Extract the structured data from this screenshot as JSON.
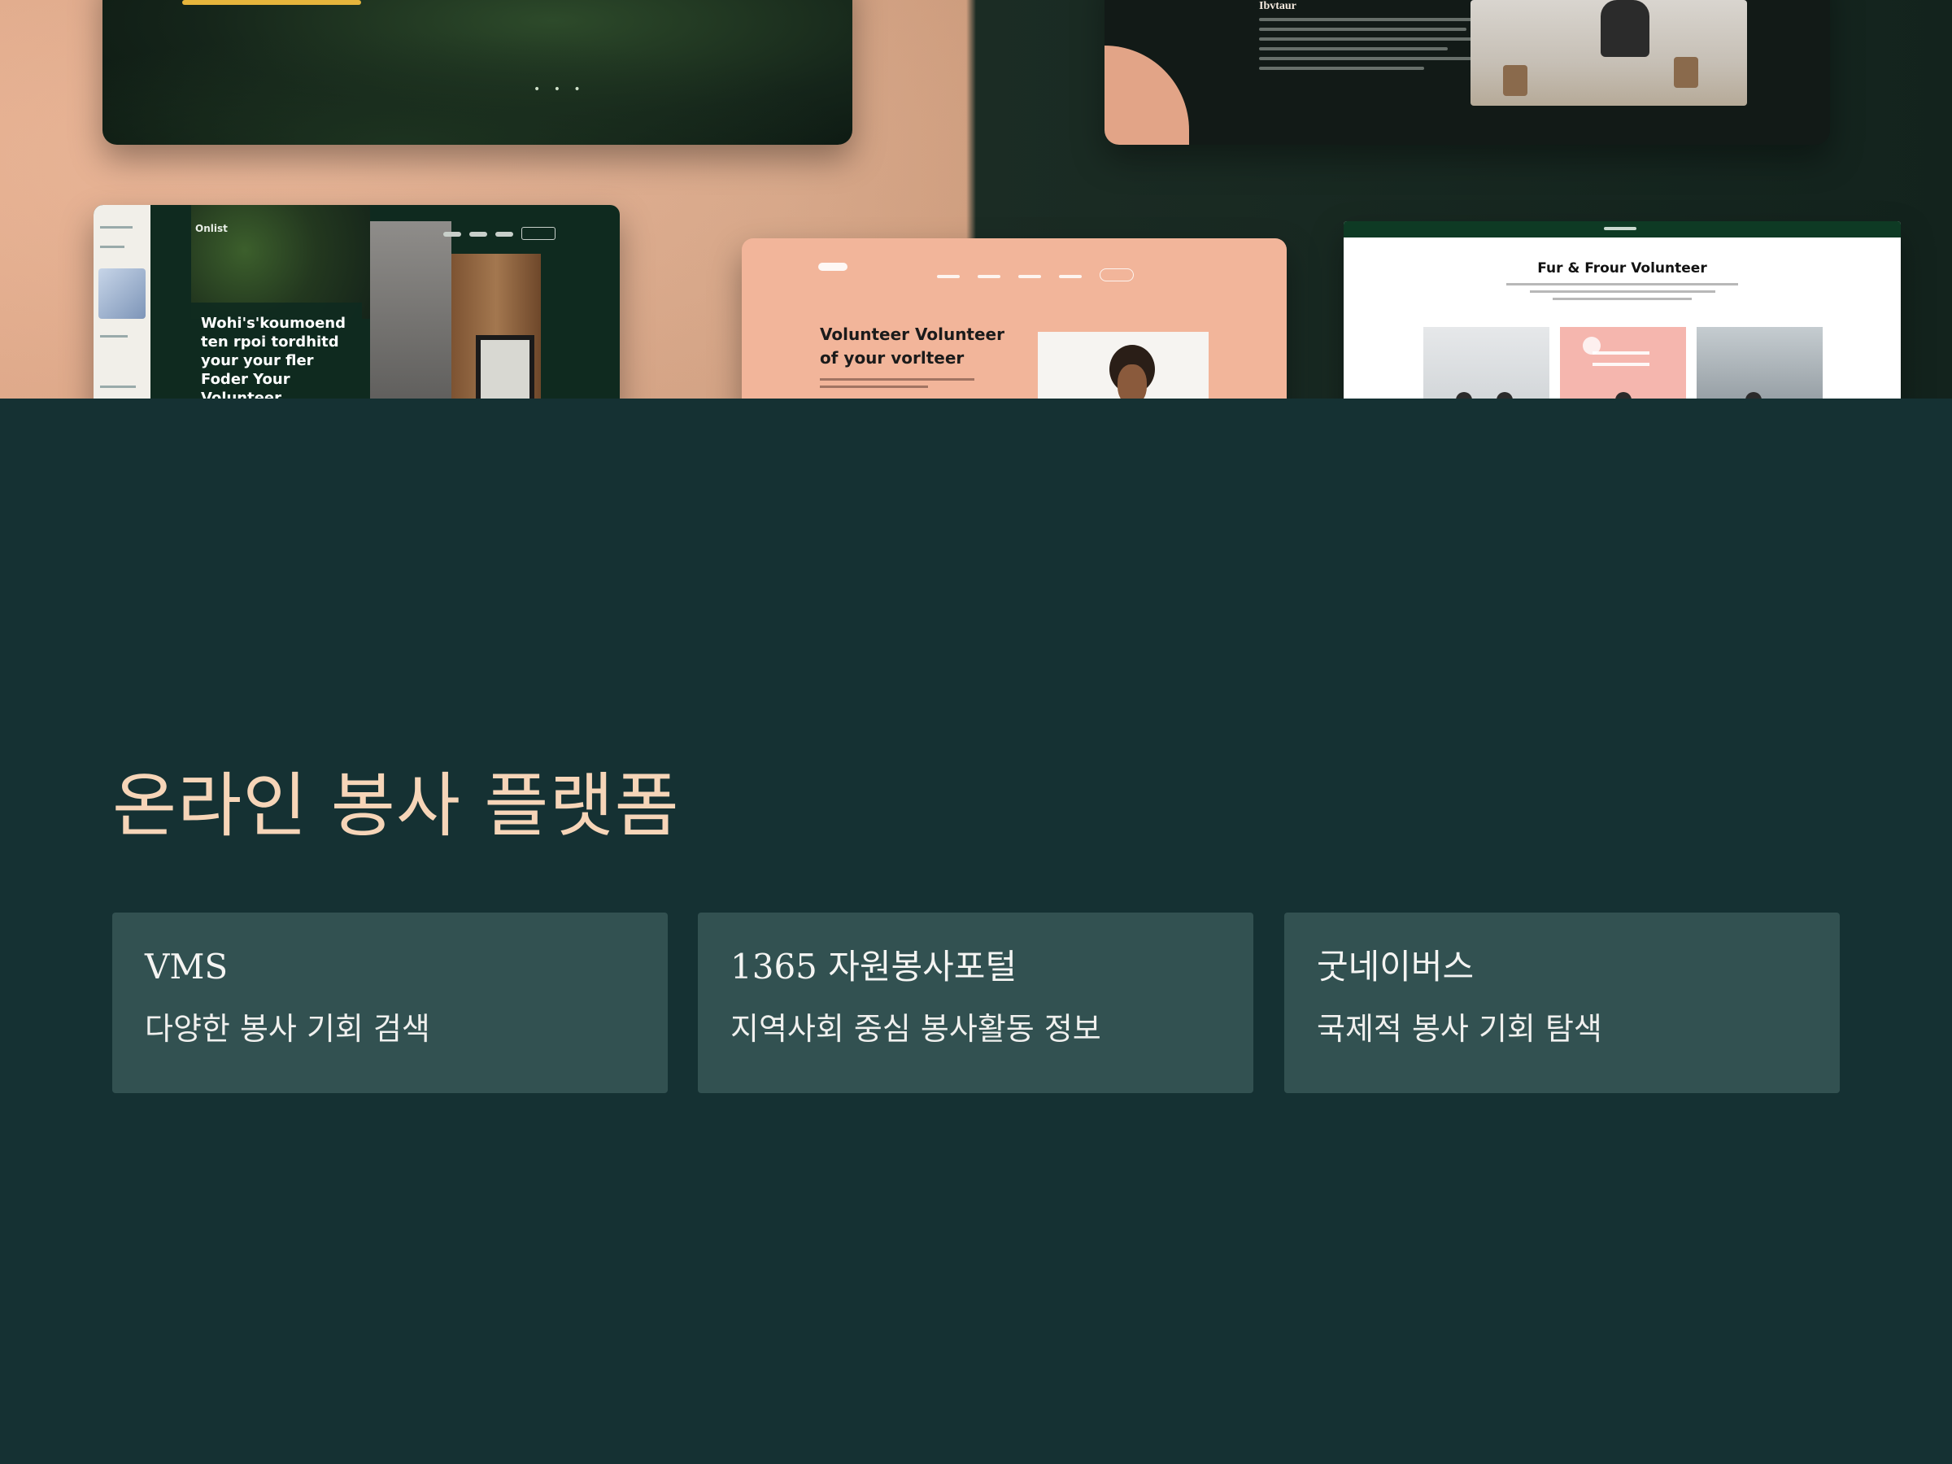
{
  "colors": {
    "background": "#153133",
    "card_background": "#325151",
    "heading": "#f6d5b8",
    "card_text": "#f4f4f2",
    "hero_peach": "#e9b08f",
    "hero_dark": "#13231d"
  },
  "hero": {
    "mockup_bottom_left_headline": "Wohi's'koumoend ten rpoi tordhitd your your fler Foder Your Volunteer",
    "mockup_bottom_middle_headline": "Volunteer Volunteer of your vorlteer",
    "mockup_bottom_right_headline": "Fur & Frour Volunteer",
    "mockup_top_right_heading": "Ibvtaur"
  },
  "section": {
    "title": "온라인 봉사 플랫폼"
  },
  "cards": [
    {
      "name": "VMS",
      "description": "다양한 봉사 기회 검색"
    },
    {
      "name": "1365 자원봉사포털",
      "description": "지역사회 중심 봉사활동 정보"
    },
    {
      "name": "굿네이버스",
      "description": "국제적 봉사 기회 탐색"
    }
  ]
}
